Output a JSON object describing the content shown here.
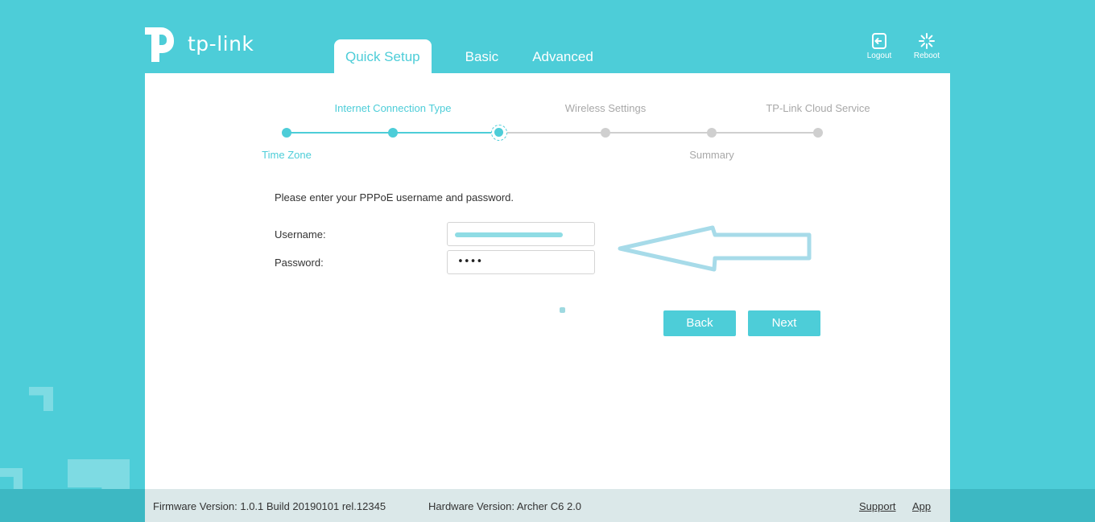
{
  "brand": {
    "logo_text": "tp-link"
  },
  "tabs": [
    {
      "label": "Quick Setup",
      "active": true
    },
    {
      "label": "Basic",
      "active": false
    },
    {
      "label": "Advanced",
      "active": false
    }
  ],
  "header_actions": {
    "logout_label": "Logout",
    "reboot_label": "Reboot"
  },
  "wizard": {
    "steps": [
      {
        "label": "Time Zone",
        "state": "done"
      },
      {
        "label": "Internet Connection Type",
        "state": "done"
      },
      {
        "label": "",
        "state": "current"
      },
      {
        "label": "Wireless Settings",
        "state": "todo"
      },
      {
        "label": "Summary",
        "state": "todo"
      },
      {
        "label": "TP-Link Cloud Service",
        "state": "todo"
      }
    ]
  },
  "form": {
    "instruction": "Please enter your PPPoE username and password.",
    "username_label": "Username:",
    "username_value": "",
    "password_label": "Password:",
    "password_value": "••••"
  },
  "buttons": {
    "back_label": "Back",
    "next_label": "Next"
  },
  "footer": {
    "firmware": "Firmware Version: 1.0.1 Build 20190101 rel.12345",
    "hardware": "Hardware Version: Archer C6 2.0",
    "support_link": "Support",
    "app_link": "App"
  },
  "colors": {
    "accent": "#4dcdd8",
    "inactive_step": "#cfcfcf",
    "panel_bg": "#ffffff",
    "footer_bg": "#dbe8e9"
  }
}
